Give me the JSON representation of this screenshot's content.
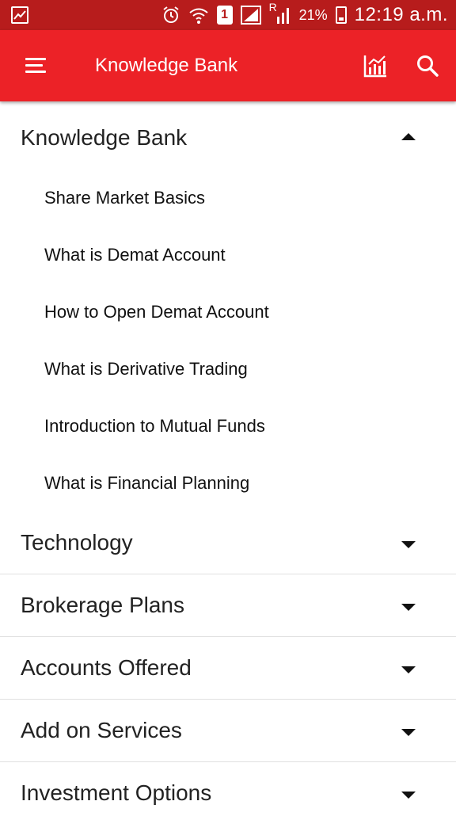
{
  "status_bar": {
    "sim_number": "1",
    "network_letter": "R",
    "battery_percent": "21%",
    "time": "12:19 a.m.",
    "icons": [
      "image-icon",
      "alarm-icon",
      "wifi-icon",
      "sim-icon",
      "signal-icon",
      "roaming-signal-icon",
      "battery-icon"
    ]
  },
  "app_bar": {
    "title": "Knowledge Bank",
    "background": "#ec2227",
    "icons": [
      "menu-icon",
      "chart-icon",
      "search-icon"
    ]
  },
  "sections": [
    {
      "label": "Knowledge Bank",
      "expanded": true,
      "items": [
        {
          "label": "Share Market Basics"
        },
        {
          "label": "What is Demat Account"
        },
        {
          "label": "How to Open Demat Account"
        },
        {
          "label": "What is Derivative Trading"
        },
        {
          "label": "Introduction to Mutual Funds"
        },
        {
          "label": "What is Financial Planning"
        }
      ]
    },
    {
      "label": "Technology",
      "expanded": false
    },
    {
      "label": "Brokerage Plans",
      "expanded": false
    },
    {
      "label": "Accounts Offered",
      "expanded": false
    },
    {
      "label": "Add on Services",
      "expanded": false
    },
    {
      "label": "Investment Options",
      "expanded": false
    }
  ]
}
